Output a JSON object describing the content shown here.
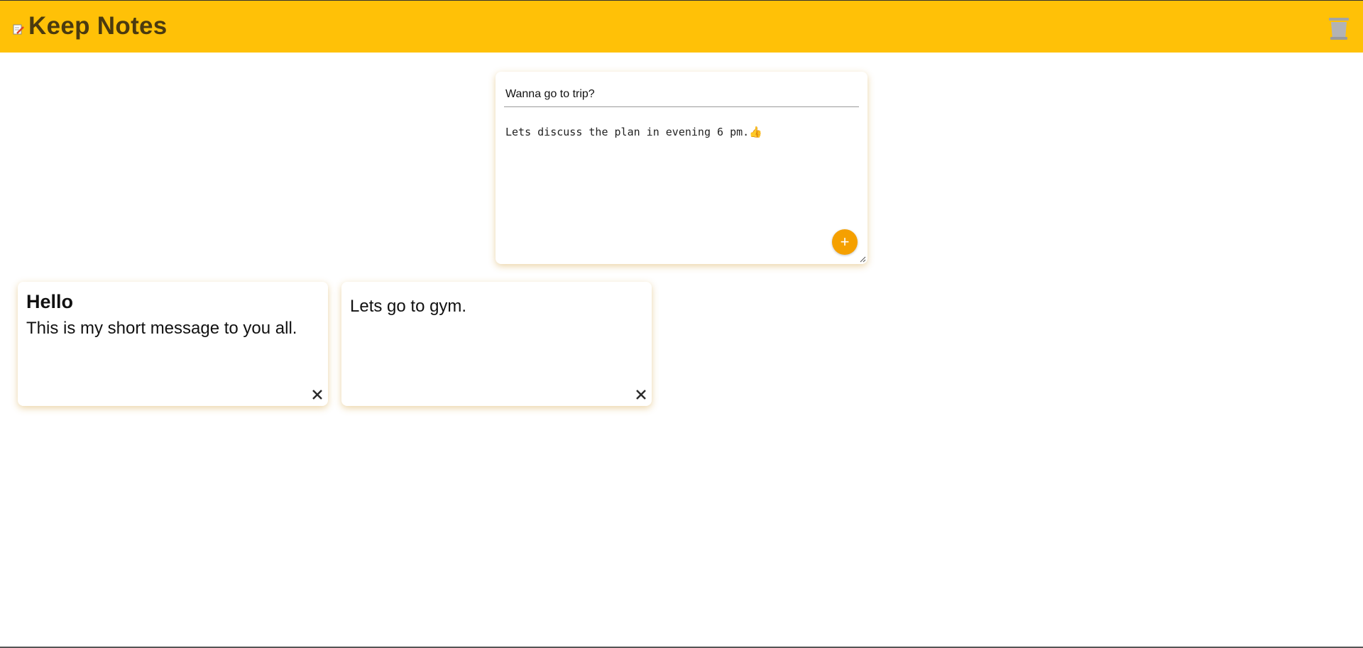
{
  "header": {
    "app_title": "Keep Notes",
    "logo_icon": "notepad-pencil-icon",
    "trash_icon": "trash-bin-icon",
    "background_color": "#ffc107"
  },
  "composer": {
    "title_value": "Wanna go to trip?",
    "content_value": "Lets discuss the plan in evening 6 pm.👍",
    "add_button_label": "+",
    "add_button_color": "#f5a000"
  },
  "notes": [
    {
      "title": "Hello",
      "content": "This is my short message to you all.",
      "delete_icon": "close-icon"
    },
    {
      "title": "",
      "content": "Lets go to gym.",
      "delete_icon": "close-icon"
    }
  ]
}
